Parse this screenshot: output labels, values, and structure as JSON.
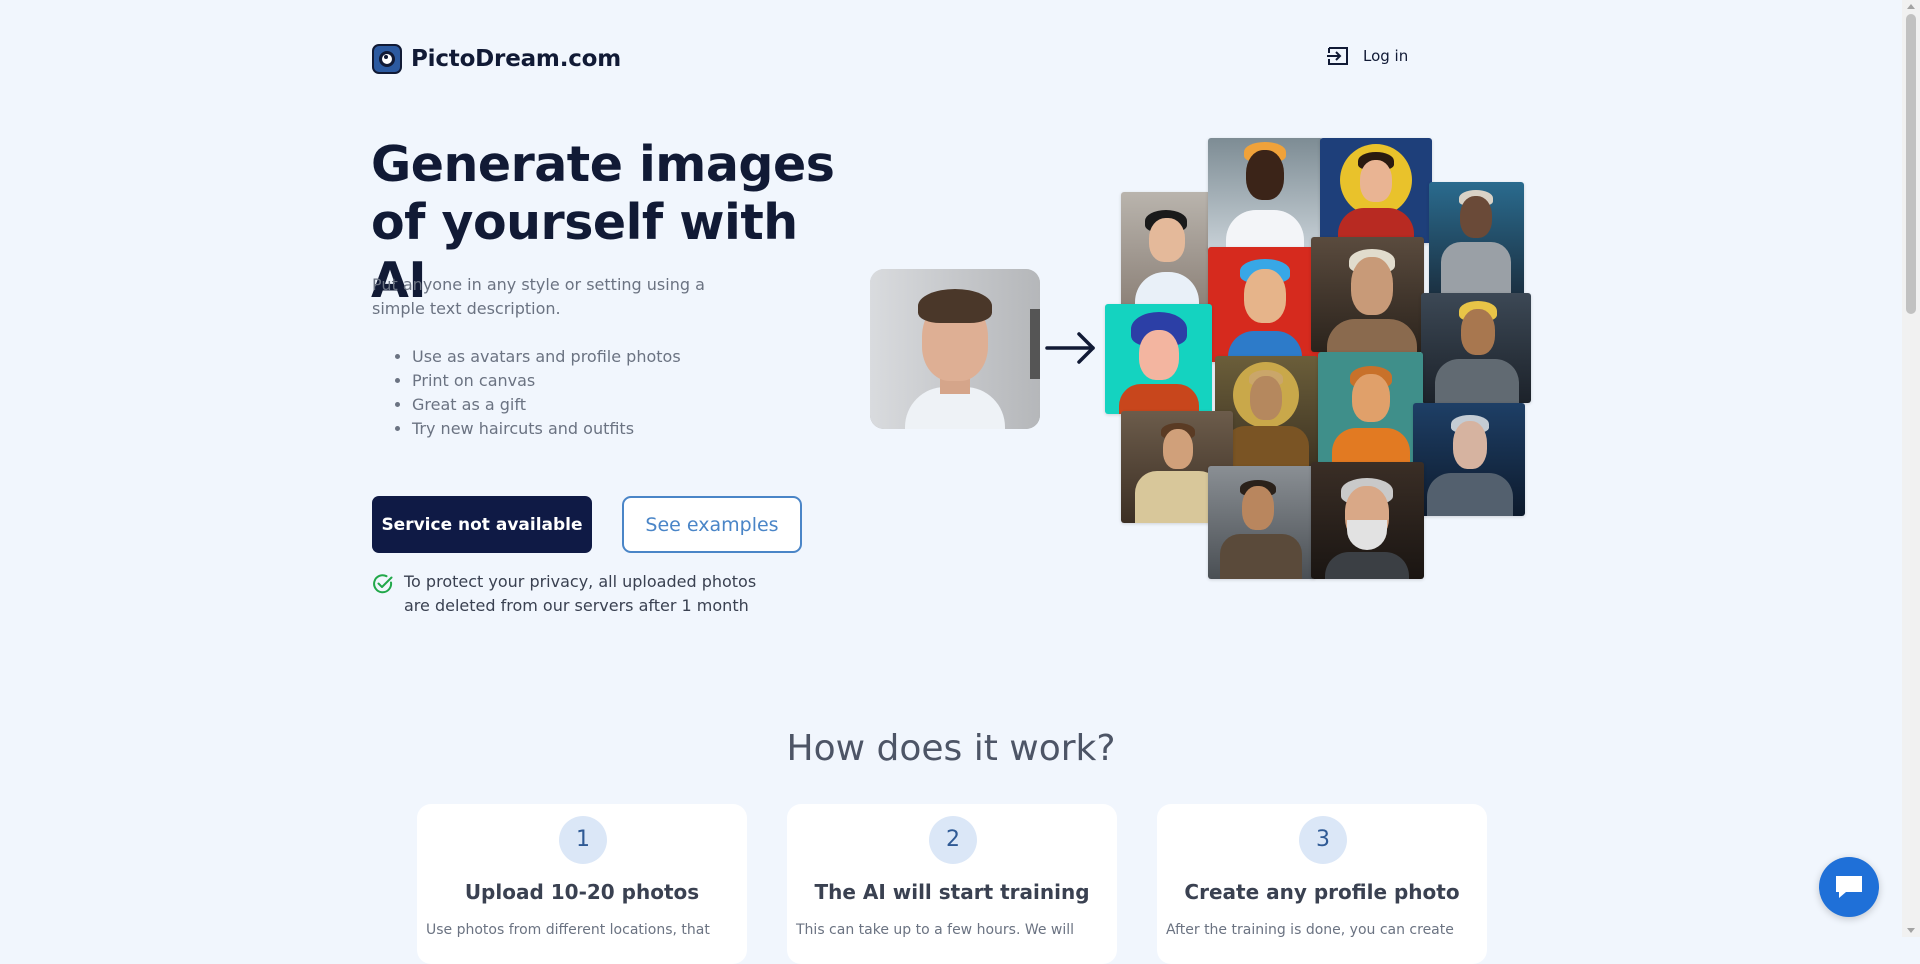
{
  "header": {
    "brand": "PictoDream.com",
    "login_label": "Log in"
  },
  "hero": {
    "title_line1": "Generate images",
    "title_line2": "of yourself with AI",
    "subtitle": "Put anyone in any style or setting using a simple text description.",
    "features": [
      "Use as avatars and profile photos",
      "Print on canvas",
      "Great as a gift",
      "Try new haircuts and outfits"
    ],
    "primary_button": "Service not available",
    "secondary_button": "See examples",
    "privacy_note": "To protect your privacy, all uploaded photos are deleted from our servers after 1 month"
  },
  "how_it_works": {
    "title": "How does it work?",
    "steps": [
      {
        "number": "1",
        "title": "Upload 10-20 photos",
        "desc": "Use photos from different locations, that"
      },
      {
        "number": "2",
        "title": "The AI will start training",
        "desc": "This can take up to a few hours. We will"
      },
      {
        "number": "3",
        "title": "Create any profile photo",
        "desc": "After the training is done, you can create"
      }
    ]
  },
  "icons": {
    "logo": "camera-lens-logo",
    "login": "login-arrow-icon",
    "arrow": "right-arrow-icon",
    "privacy": "check-circle-icon",
    "chat": "chat-bubble-icon"
  },
  "colors": {
    "background": "#f1f6fd",
    "primary_dark": "#0f1a45",
    "accent_blue": "#4a85c7",
    "check_green": "#22a84a",
    "chat_blue": "#1f70d8"
  }
}
